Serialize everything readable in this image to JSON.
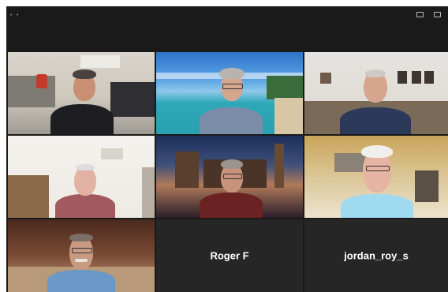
{
  "window": {
    "top_right_buttons": [
      {
        "label": "",
        "icon": "speaker-view-icon"
      },
      {
        "label": "",
        "icon": "fullscreen-icon"
      }
    ]
  },
  "tiles": [
    {
      "name_tag": "",
      "big_name": "",
      "active": false
    },
    {
      "name_tag": "",
      "big_name": "",
      "active": false
    },
    {
      "name_tag": "",
      "big_name": "",
      "active": false
    },
    {
      "name_tag": "",
      "big_name": "",
      "active": false
    },
    {
      "name_tag": "",
      "big_name": "",
      "active": true
    },
    {
      "name_tag": "",
      "big_name": "",
      "active": false
    },
    {
      "name_tag": "",
      "big_name": "",
      "active": false
    },
    {
      "name_tag": "",
      "big_name": "Roger F",
      "active": false
    },
    {
      "name_tag": "",
      "big_name": "jordan_roy_s",
      "active": false
    }
  ],
  "colors": {
    "background": "#1a1a1a",
    "active_speaker_border": "#c5d25a",
    "tile_empty": "#262626"
  }
}
